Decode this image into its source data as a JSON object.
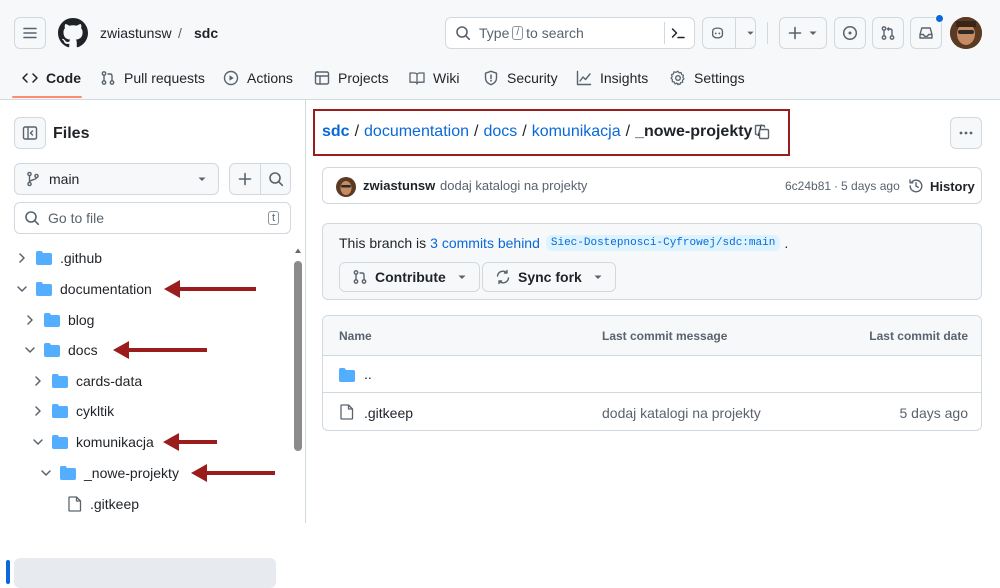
{
  "header": {
    "owner": "zwiastunsw",
    "separator": "/",
    "repo": "sdc",
    "search_prefix": "Type",
    "search_key": "/",
    "search_suffix": "to search"
  },
  "tabs": [
    {
      "label": "Code"
    },
    {
      "label": "Pull requests"
    },
    {
      "label": "Actions"
    },
    {
      "label": "Projects"
    },
    {
      "label": "Wiki"
    },
    {
      "label": "Security"
    },
    {
      "label": "Insights"
    },
    {
      "label": "Settings"
    }
  ],
  "sidebar": {
    "title": "Files",
    "branch": "main",
    "goto_placeholder": "Go to file",
    "goto_key": "t",
    "tree": [
      {
        "label": ".github"
      },
      {
        "label": "documentation"
      },
      {
        "label": "blog"
      },
      {
        "label": "docs"
      },
      {
        "label": "cards-data"
      },
      {
        "label": "cykltik"
      },
      {
        "label": "komunikacja"
      },
      {
        "label": "_nowe-projekty"
      },
      {
        "label": ".gitkeep"
      }
    ]
  },
  "breadcrumb": {
    "items": [
      "sdc",
      "documentation",
      "docs",
      "komunikacja"
    ],
    "current": "_nowe-projekty",
    "sep": "/"
  },
  "commit": {
    "author": "zwiastunsw",
    "message": "dodaj katalogi na projekty",
    "sha": "6c24b81",
    "dot": "·",
    "age": "5 days ago",
    "history": "History"
  },
  "branch_status": {
    "prefix": "This branch is",
    "link": "3 commits behind",
    "ref": "Siec-Dostepnosci-Cyfrowej/sdc:main",
    "suffix": ".",
    "contribute": "Contribute",
    "sync": "Sync fork"
  },
  "files_table": {
    "headers": [
      "Name",
      "Last commit message",
      "Last commit date"
    ],
    "parent": "..",
    "rows": [
      {
        "name": ".gitkeep",
        "message": "dodaj katalogi na projekty",
        "date": "5 days ago"
      }
    ]
  },
  "colors": {
    "accent": "#0969da",
    "annotation": "#9b1c1c",
    "folder": "#54aeff",
    "tab_underline": "#fd8c73"
  }
}
